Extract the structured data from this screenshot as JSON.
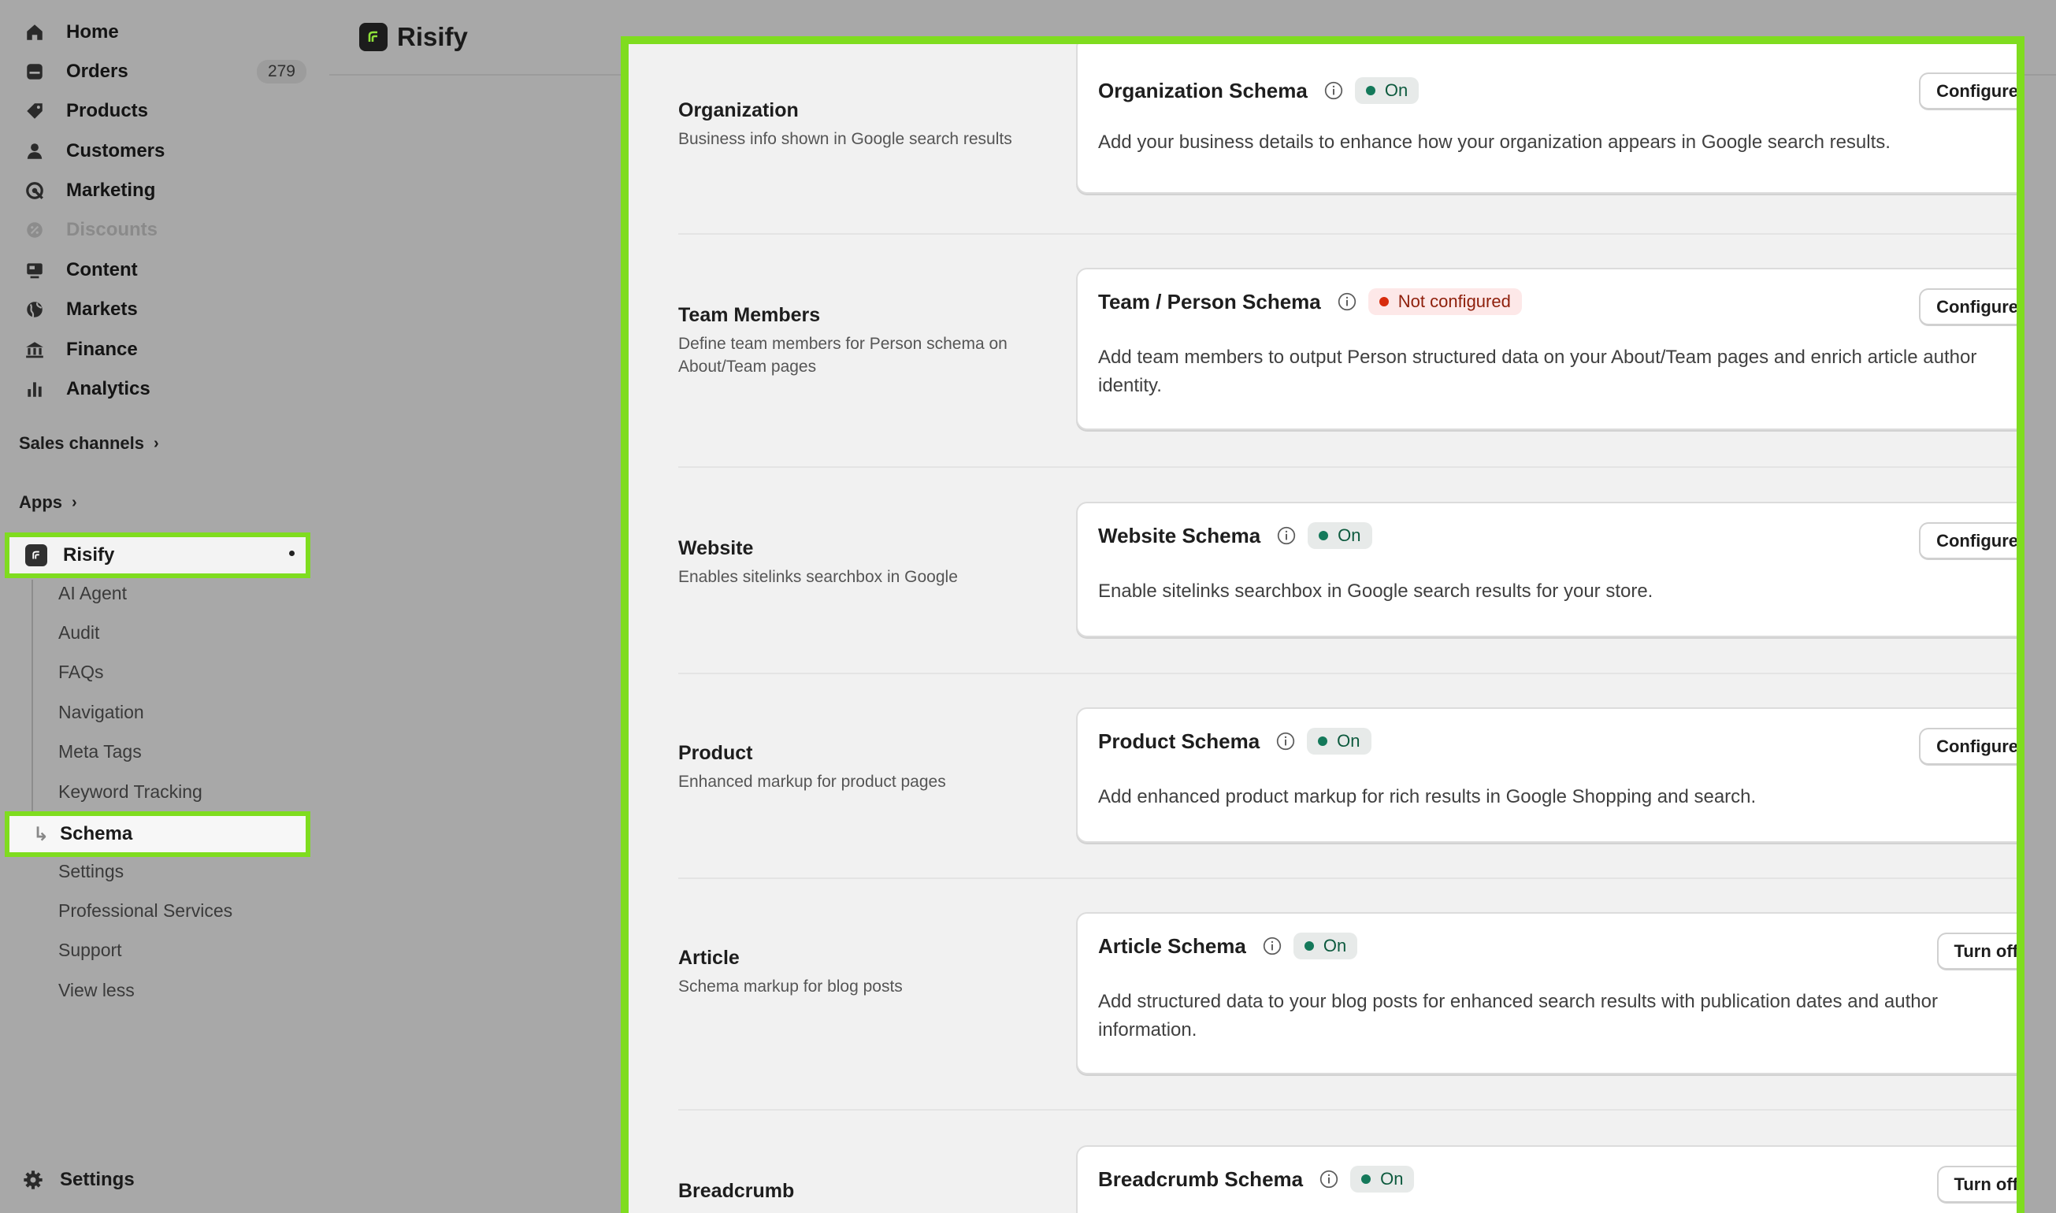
{
  "sidebar": {
    "nav": [
      {
        "label": "Home",
        "icon": "home-icon"
      },
      {
        "label": "Orders",
        "icon": "orders-icon",
        "count": "279"
      },
      {
        "label": "Products",
        "icon": "tag-icon"
      },
      {
        "label": "Customers",
        "icon": "person-icon"
      },
      {
        "label": "Marketing",
        "icon": "marketing-icon"
      },
      {
        "label": "Discounts",
        "icon": "discount-icon",
        "disabled": true
      },
      {
        "label": "Content",
        "icon": "content-icon"
      },
      {
        "label": "Markets",
        "icon": "globe-icon"
      },
      {
        "label": "Finance",
        "icon": "bank-icon"
      },
      {
        "label": "Analytics",
        "icon": "chart-bar-icon"
      }
    ],
    "sales_channels": "Sales channels",
    "apps": "Apps",
    "app_name": "Risify",
    "sub_items": [
      "AI Agent",
      "Audit",
      "FAQs",
      "Navigation",
      "Meta Tags",
      "Keyword Tracking"
    ],
    "active_sub_item": "Schema",
    "sub_items_after": [
      "Settings",
      "Professional Services",
      "Support",
      "View less"
    ],
    "settings": "Settings"
  },
  "header": {
    "title": "Risify"
  },
  "sections": [
    {
      "title": "Organization",
      "desc": "Business info shown in Google search results",
      "card_title": "Organization Schema",
      "status": "On",
      "status_kind": "on",
      "button": "Configure",
      "card_desc": "Add your business details to enhance how your organization appears in Google search results."
    },
    {
      "title": "Team Members",
      "desc": "Define team members for Person schema on About/Team pages",
      "card_title": "Team / Person Schema",
      "status": "Not configured",
      "status_kind": "off",
      "button": "Configure",
      "card_desc": "Add team members to output Person structured data on your About/Team pages and enrich article author identity."
    },
    {
      "title": "Website",
      "desc": "Enables sitelinks searchbox in Google",
      "card_title": "Website Schema",
      "status": "On",
      "status_kind": "on",
      "button": "Configure",
      "card_desc": "Enable sitelinks searchbox in Google search results for your store."
    },
    {
      "title": "Product",
      "desc": "Enhanced markup for product pages",
      "card_title": "Product Schema",
      "status": "On",
      "status_kind": "on",
      "button": "Configure",
      "card_desc": "Add enhanced product markup for rich results in Google Shopping and search."
    },
    {
      "title": "Article",
      "desc": "Schema markup for blog posts",
      "card_title": "Article Schema",
      "status": "On",
      "status_kind": "on",
      "button": "Turn off",
      "card_desc": "Add structured data to your blog posts for enhanced search results with publication dates and author information."
    },
    {
      "title": "Breadcrumb",
      "desc": "",
      "card_title": "Breadcrumb Schema",
      "status": "On",
      "status_kind": "on",
      "button": "Turn off",
      "card_desc": ""
    }
  ],
  "colors": {
    "highlight": "#7fdc1f",
    "status_on": "#14795a",
    "status_off": "#d72c0d"
  }
}
